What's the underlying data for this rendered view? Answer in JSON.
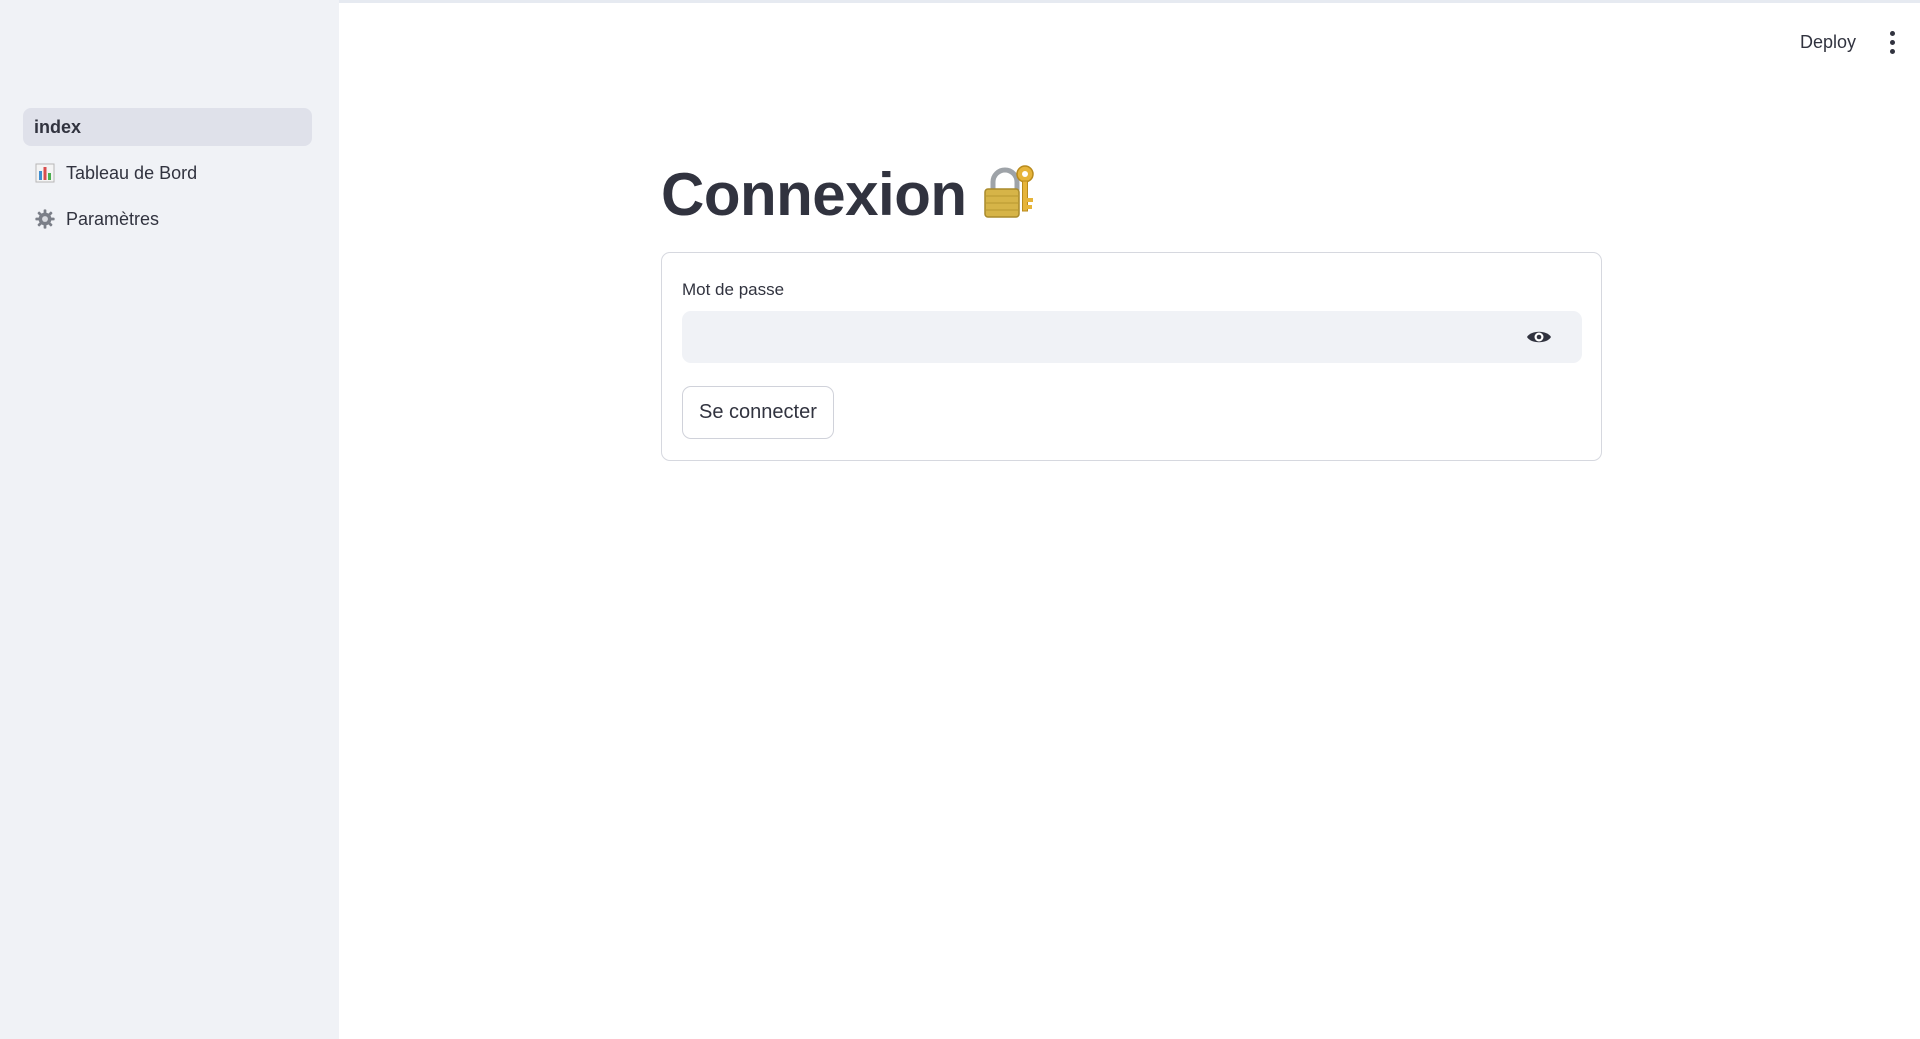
{
  "app": {
    "deploy_label": "Deploy",
    "menu_icon": "kebab-menu-icon"
  },
  "sidebar": {
    "items": [
      {
        "label": "index",
        "icon": null,
        "active": true
      },
      {
        "label": "Tableau de Bord",
        "icon": "bar-chart-icon",
        "active": false
      },
      {
        "label": "Paramètres",
        "icon": "gear-icon",
        "active": false
      }
    ]
  },
  "main": {
    "title": "Connexion",
    "title_icon": "locked-with-key-icon",
    "form": {
      "password_label": "Mot de passe",
      "password_value": "",
      "password_toggle_icon": "eye-icon",
      "submit_label": "Se connecter"
    }
  }
}
